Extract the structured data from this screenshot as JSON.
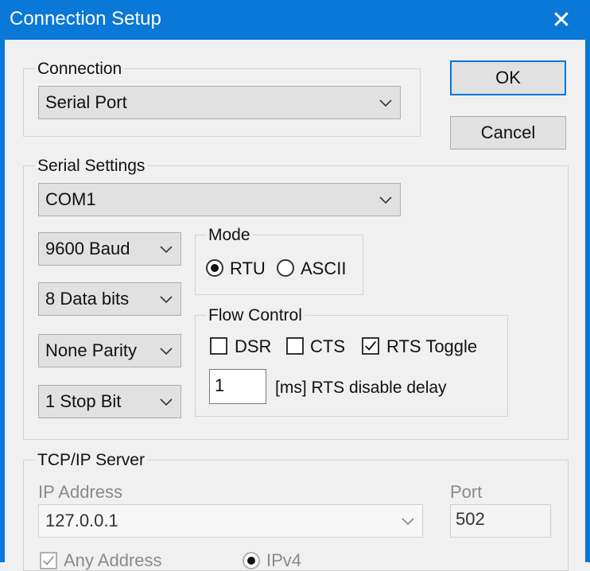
{
  "window": {
    "title": "Connection Setup",
    "close_symbol": "✕"
  },
  "buttons": {
    "ok": "OK",
    "cancel": "Cancel"
  },
  "connection": {
    "group_label": "Connection",
    "selected": "Serial Port"
  },
  "serial_settings": {
    "group_label": "Serial Settings",
    "port": "COM1",
    "baud": "9600 Baud",
    "data_bits": "8 Data bits",
    "parity": "None Parity",
    "stop_bits": "1 Stop Bit",
    "mode": {
      "label": "Mode",
      "rtu": "RTU",
      "ascii": "ASCII",
      "selected": "RTU"
    },
    "flow_control": {
      "label": "Flow Control",
      "dsr": "DSR",
      "cts": "CTS",
      "rts_toggle": "RTS Toggle",
      "rts_toggle_checked": true,
      "dsr_checked": false,
      "cts_checked": false,
      "delay_value": "1",
      "delay_label": "[ms] RTS disable delay"
    }
  },
  "tcp_ip": {
    "group_label": "TCP/IP Server",
    "ip_label": "IP Address",
    "ip_value": "127.0.0.1",
    "port_label": "Port",
    "port_value": "502",
    "any_address": "Any Address",
    "any_address_checked": true,
    "ipv4": "IPv4"
  }
}
